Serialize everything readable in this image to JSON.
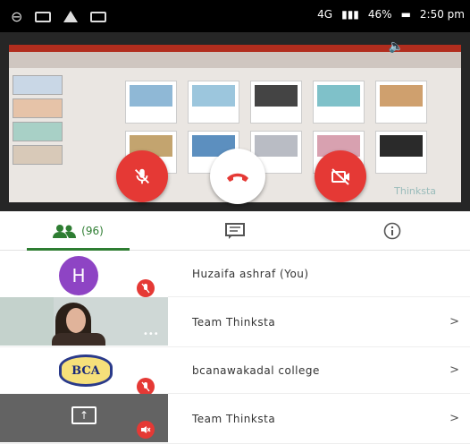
{
  "status_bar": {
    "network": "4G",
    "signal_text": "46%",
    "time": "2:50 pm"
  },
  "presentation": {
    "watermark": "Thinksta"
  },
  "tabs": {
    "people_count": "(96)"
  },
  "participants": [
    {
      "avatar_letter": "H",
      "name": "Huzaifa ashraf (You)",
      "chevron": ""
    },
    {
      "avatar_letter": "",
      "name": "Team Thinksta",
      "chevron": ">"
    },
    {
      "avatar_letter": "",
      "name": "bcanawakadal college",
      "chevron": ">"
    },
    {
      "avatar_letter": "",
      "name": "Team Thinksta",
      "chevron": ">"
    }
  ],
  "colors": {
    "accent_green": "#2e7d32",
    "end_call_red": "#e53935",
    "avatar_purple": "#8e44c4"
  }
}
